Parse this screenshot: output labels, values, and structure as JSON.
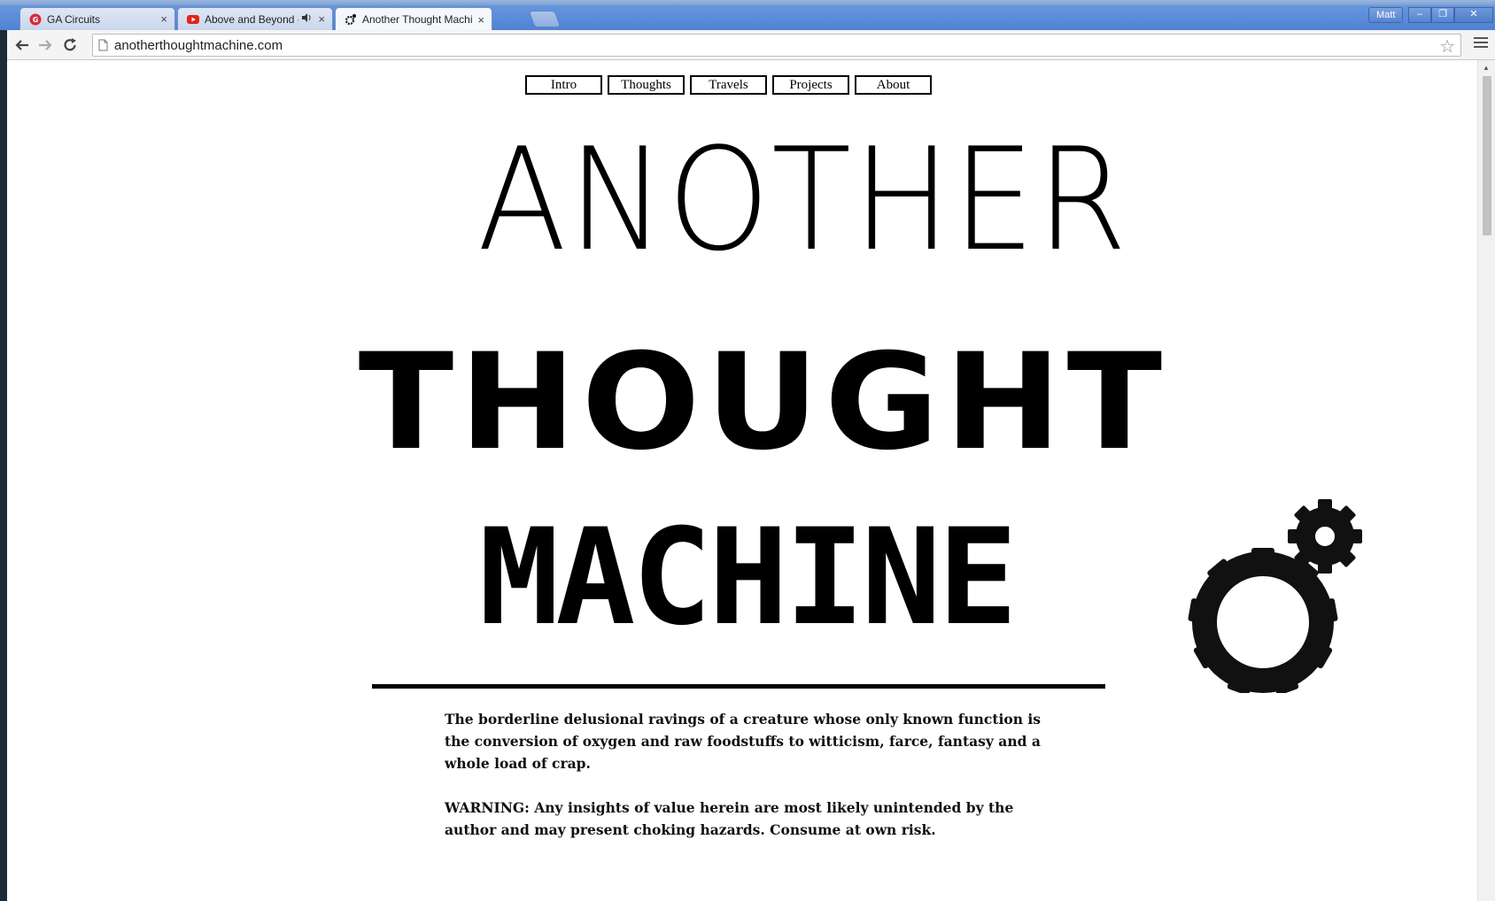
{
  "browser": {
    "tabs": [
      {
        "title": "GA Circuits",
        "active": false
      },
      {
        "title": "Above and Beyond - A",
        "active": false,
        "audio": true
      },
      {
        "title": "Another Thought Machine",
        "active": true
      }
    ],
    "close_glyph": "×",
    "user_name": "Matt",
    "window_buttons": {
      "minimize": "–",
      "restore": "❐",
      "close": "✕"
    },
    "url": "anotherthoughtmachine.com"
  },
  "site": {
    "nav": [
      "Intro",
      "Thoughts",
      "Travels",
      "Projects",
      "About"
    ],
    "title": {
      "line1": "ANOTHER",
      "line2": "THOUGHT",
      "line3": "MACHINE"
    },
    "description": [
      "The borderline delusional ravings of a creature whose only known function is the conversion of oxygen and raw foodstuffs to witticism, farce, fantasy and a whole load of crap.",
      "WARNING: Any insights of value herein are most likely unintended by the author and may present choking hazards. Consume at own risk."
    ]
  },
  "colors": {
    "titlebar": "#5b8ad8",
    "page_background": "#ffffff",
    "text": "#000000"
  },
  "icons": [
    "back-arrow-icon",
    "forward-arrow-icon",
    "reload-icon",
    "page-icon",
    "star-icon",
    "menu-icon",
    "gears-icon"
  ]
}
